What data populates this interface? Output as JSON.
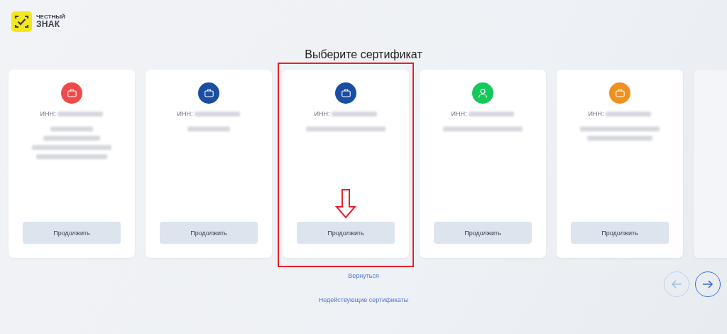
{
  "logo": {
    "line_1": "ЧЕСТНЫЙ",
    "line_2": "ЗНАК"
  },
  "title": "Выберите сертификат",
  "cards": [
    {
      "kind": "organization",
      "color": "#f04b4b",
      "inn_label": "ИНН:",
      "button": "Продолжить",
      "highlighted": false
    },
    {
      "kind": "organization",
      "color": "#1a4ea3",
      "inn_label": "ИНН:",
      "button": "Продолжить",
      "highlighted": false
    },
    {
      "kind": "organization",
      "color": "#1a4ea3",
      "inn_label": "ИНН:",
      "button": "Продолжить",
      "highlighted": true
    },
    {
      "kind": "person",
      "color": "#14c85a",
      "inn_label": "ИНН:",
      "button": "Продолжить",
      "highlighted": false
    },
    {
      "kind": "organization",
      "color": "#f0901e",
      "inn_label": "ИНН:",
      "button": "Продолжить",
      "highlighted": false
    },
    {
      "kind": "partial"
    }
  ],
  "nav": {
    "prev_disabled": true,
    "next_disabled": false
  },
  "back_link": "Вернуться",
  "invalid_link": "Недействующие сертификаты"
}
